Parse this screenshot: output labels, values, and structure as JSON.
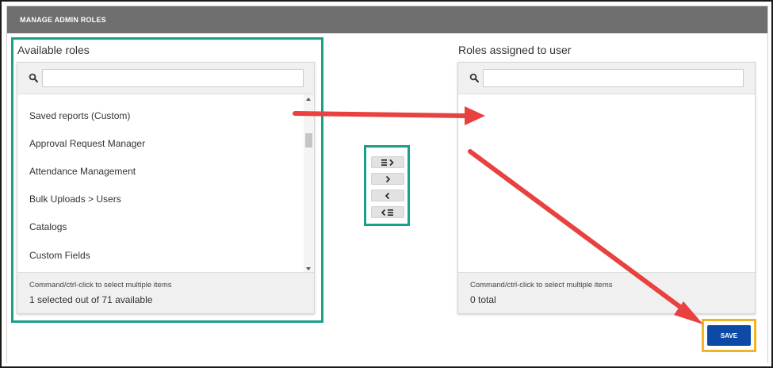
{
  "header": {
    "title": "MANAGE ADMIN ROLES"
  },
  "available": {
    "title": "Available roles",
    "search_placeholder": "",
    "items": [
      "Saved reports (Custom)",
      "Approval Request Manager",
      "Attendance Management",
      "Bulk Uploads > Users",
      "Catalogs",
      "Custom Fields"
    ],
    "hint": "Command/ctrl-click to select multiple items",
    "count": "1 selected out of 71 available"
  },
  "assigned": {
    "title": "Roles assigned to user",
    "search_placeholder": "",
    "hint": "Command/ctrl-click to select multiple items",
    "count": "0 total"
  },
  "controls": {
    "move_all_right_icon": "list-chevron-right-icon",
    "move_right_icon": "chevron-right-icon",
    "move_left_icon": "chevron-left-icon",
    "move_all_left_icon": "chevron-left-list-icon"
  },
  "save_label": "SAVE",
  "colors": {
    "header_bg": "#6e6e6e",
    "highlight_green": "#1aa08a",
    "highlight_orange": "#f0b429",
    "save_blue": "#0c4aa6",
    "annotation_red": "#e8413f"
  }
}
